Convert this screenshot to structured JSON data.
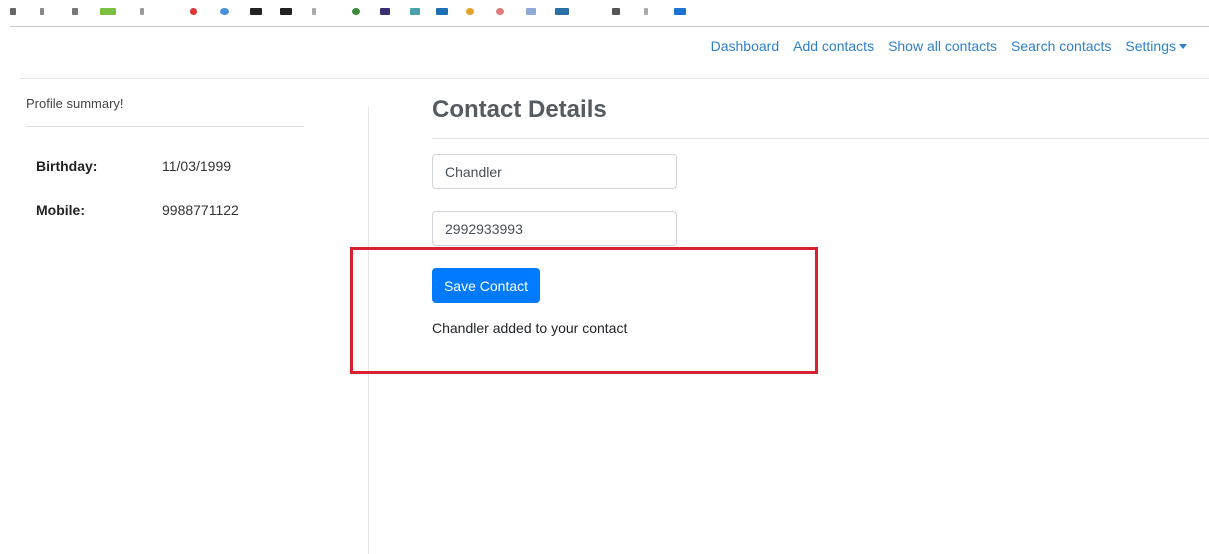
{
  "navbar": {
    "links": [
      "Dashboard",
      "Add contacts",
      "Show all contacts",
      "Search contacts"
    ],
    "settings_label": "Settings"
  },
  "sidebar": {
    "title": "Profile summary!",
    "rows": [
      {
        "label": "Birthday:",
        "value": "11/03/1999"
      },
      {
        "label": "Mobile:",
        "value": "9988771122"
      }
    ]
  },
  "main": {
    "title": "Contact Details",
    "name_value": "Chandler",
    "phone_value": "2992933993",
    "save_label": "Save Contact",
    "status": "Chandler added to your contact"
  },
  "colors": {
    "primary": "#007bff",
    "link": "#2f80c9",
    "highlight": "#d9202f"
  }
}
